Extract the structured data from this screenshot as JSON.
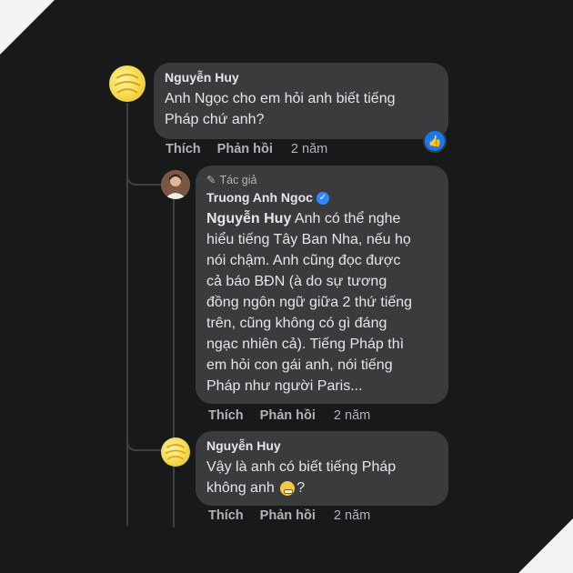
{
  "comment1": {
    "author": "Nguyễn Huy",
    "text": "Anh Ngọc cho em hỏi anh biết tiếng\nPháp chứ anh?",
    "actions": {
      "like": "Thích",
      "reply": "Phản hồi",
      "time": "2 năm"
    },
    "reaction_icon": "thumbs-up-icon"
  },
  "reply1": {
    "badge": "Tác giả",
    "author": "Truong Anh Ngoc",
    "tag": "Nguyễn Huy",
    "text": " Anh có thể nghe\nhiểu tiếng Tây Ban Nha, nếu họ\nnói chậm. Anh cũng đọc được\ncả báo BĐN (à do sự tương\nđồng ngôn ngữ giữa 2 thứ tiếng\ntrên, cũng không có gì đáng\nngạc nhiên cả). Tiếng Pháp thì\nem hỏi con gái anh, nói tiếng\nPháp như người Paris...",
    "actions": {
      "like": "Thích",
      "reply": "Phản hồi",
      "time": "2 năm"
    }
  },
  "reply2": {
    "author": "Nguyễn Huy",
    "text_before": "Vậy là anh có biết tiếng Pháp\nkhông anh ",
    "text_after": "?",
    "emoji": "grimacing-emoji",
    "actions": {
      "like": "Thích",
      "reply": "Phản hồi",
      "time": "2 năm"
    }
  },
  "colors": {
    "background": "#18191a",
    "bubble": "#3a3b3c",
    "text": "#e4e6eb",
    "muted": "#b0b3b8",
    "accent": "#1877f2"
  }
}
